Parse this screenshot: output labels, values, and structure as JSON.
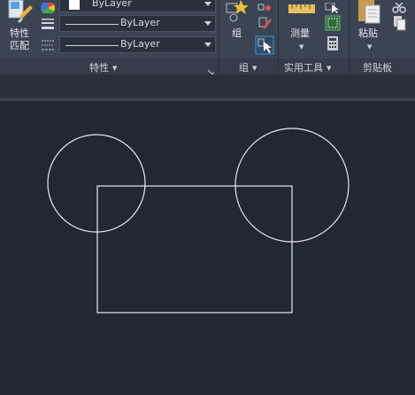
{
  "ribbon": {
    "properties": {
      "match_properties_label": "特性\n匹配",
      "dropdowns": [
        {
          "value": "ByLayer"
        },
        {
          "value": "ByLayer"
        },
        {
          "value": "ByLayer"
        }
      ],
      "panel_label": "特性"
    },
    "group": {
      "group_button_label": "组",
      "panel_label": "组"
    },
    "utilities": {
      "measure_button_label": "测量",
      "panel_label": "实用工具"
    },
    "clipboard": {
      "paste_button_label": "粘贴",
      "panel_label": "剪贴板"
    }
  },
  "colors": {
    "ribbon_bg": "#3b4453",
    "canvas_bg": "#212830",
    "drawing_stroke": "#e8e8e8"
  }
}
